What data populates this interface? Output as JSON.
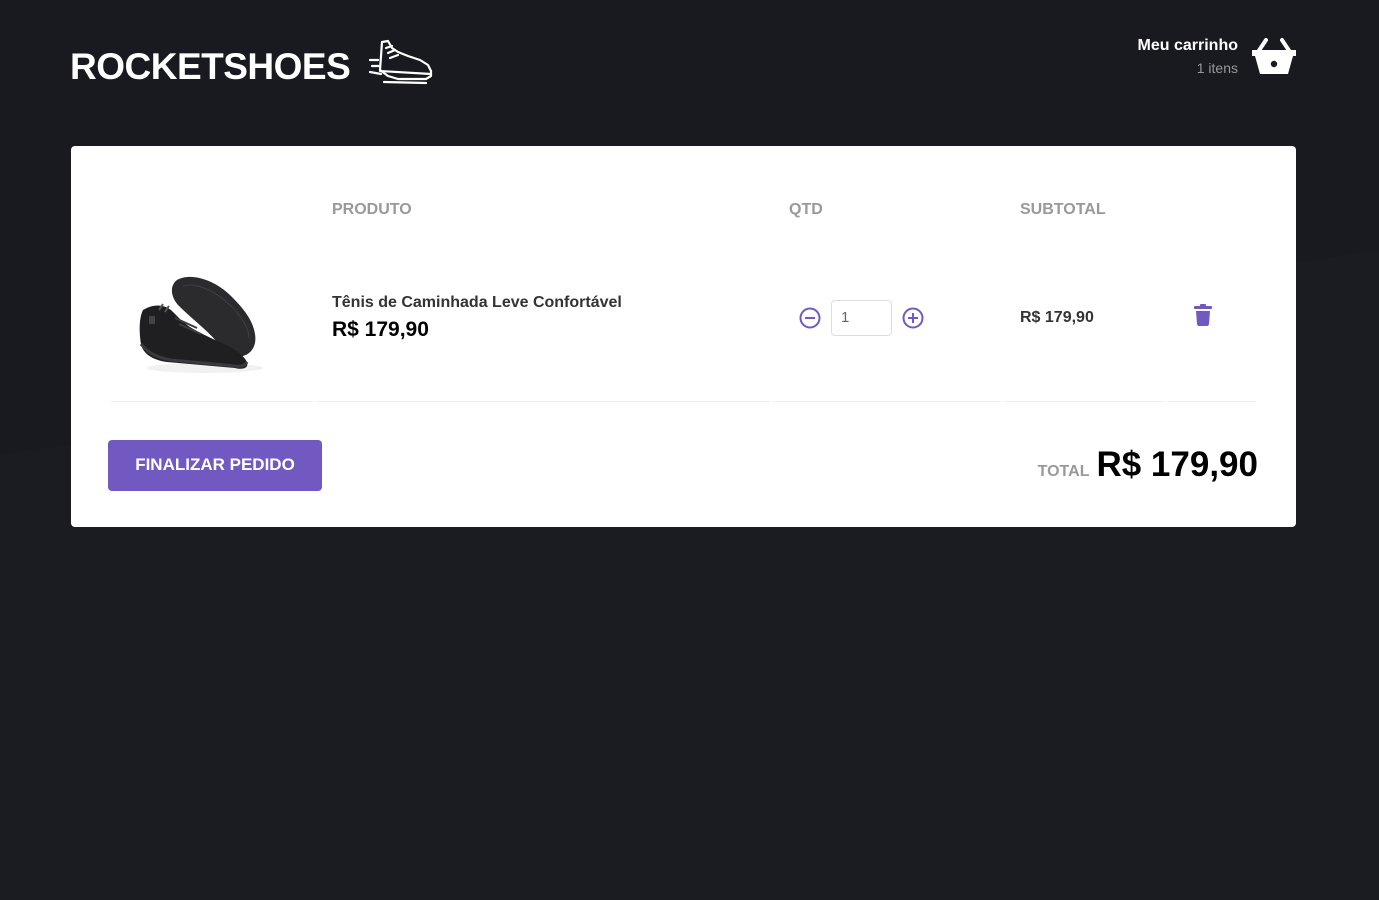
{
  "header": {
    "logo_text": "ROCKETSHOES",
    "logo_icon": "sneaker-icon",
    "cart_title": "Meu carrinho",
    "cart_count": "1 itens",
    "cart_icon": "shopping-basket-icon"
  },
  "table": {
    "headers": {
      "product": "PRODUTO",
      "quantity": "QTD",
      "subtotal": "SUBTOTAL"
    },
    "rows": [
      {
        "title": "Tênis de Caminhada Leve Confortável",
        "price": "R$ 179,90",
        "quantity": "1",
        "subtotal": "R$ 179,90",
        "image": "black-sneaker-image"
      }
    ]
  },
  "footer": {
    "finish_label": "Finalizar pedido",
    "total_label": "TOTAL",
    "total_value": "R$ 179,90"
  },
  "colors": {
    "background": "#1b1c21",
    "accent": "#7159c1",
    "card": "#ffffff"
  }
}
